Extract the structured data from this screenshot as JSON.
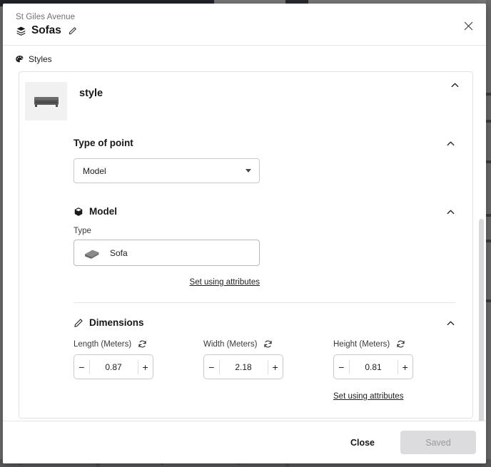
{
  "background": {
    "bottom_toolbar_icons": [
      "⌂",
      "◔",
      "✂",
      "▭",
      "",
      "↯",
      "↻"
    ]
  },
  "header": {
    "breadcrumb": "St Giles Avenue",
    "title": "Sofas",
    "layers_icon": "layers-icon",
    "edit_icon": "pencil-icon",
    "close_icon": "close-icon"
  },
  "styles_section": {
    "label": "Styles",
    "icon": "palette-icon"
  },
  "style_card": {
    "title": "style",
    "thumbnail_icon": "sofa-thumbnail",
    "collapse_icon": "chevron-up-icon",
    "type_of_point": {
      "label": "Type of point",
      "value": "Model",
      "collapse_icon": "chevron-up-icon",
      "caret_icon": "chevron-down-icon"
    },
    "model": {
      "heading": "Model",
      "heading_icon": "cube-icon",
      "collapse_icon": "chevron-up-icon",
      "type_label": "Type",
      "type_value": "Sofa",
      "type_icon": "sofa-model-icon",
      "attributes_link": "Set using attributes"
    },
    "dimensions": {
      "heading": "Dimensions",
      "heading_icon": "ruler-icon",
      "collapse_icon": "chevron-up-icon",
      "attributes_link": "Set using attributes",
      "fields": [
        {
          "label": "Length (Meters)",
          "value": "0.87",
          "refresh_icon": "refresh-icon",
          "minus": "−",
          "plus": "+"
        },
        {
          "label": "Width (Meters)",
          "value": "2.18",
          "refresh_icon": "refresh-icon",
          "minus": "−",
          "plus": "+"
        },
        {
          "label": "Height (Meters)",
          "value": "0.81",
          "refresh_icon": "refresh-icon",
          "minus": "−",
          "plus": "+"
        }
      ]
    }
  },
  "footer": {
    "close_label": "Close",
    "save_label": "Saved",
    "save_disabled": true
  },
  "colors": {
    "page_bg": "#6e6e6e",
    "modal_bg": "#ffffff",
    "border": "#e2e2e4",
    "text": "#17171a",
    "muted_text": "#6f6f73",
    "disabled_button_bg": "#dcdcde",
    "disabled_button_text": "#9a9a9e",
    "scrollbar": "#d8d8da"
  }
}
